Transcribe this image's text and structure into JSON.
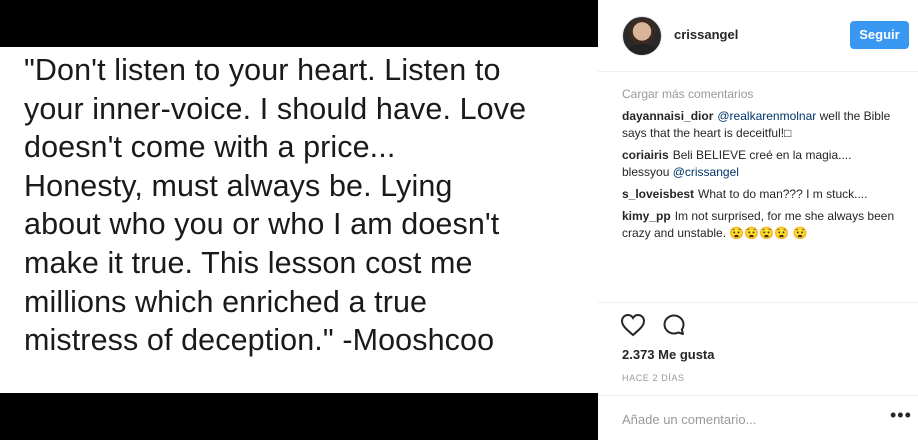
{
  "media": {
    "quote": "\"Don't listen to your heart. Listen to\nyour inner-voice. I should have. Love\ndoesn't come with a price...\nHonesty, must always be.  Lying\nabout who you or who I am doesn't\nmake it true. This lesson cost me\nmillions which enriched a true\nmistress of deception.\" -Mooshcoo"
  },
  "header": {
    "username": "crissangel",
    "follow_label": "Seguir"
  },
  "comments": {
    "load_more": "Cargar más comentarios",
    "items": [
      {
        "author": "dayannaisi_dior",
        "mention": "@realkarenmolnar",
        "text": " well the Bible says that the heart is deceitful!□"
      },
      {
        "author": "coriairis",
        "text": "Beli BELIEVE creé en la magia.... blessyou ",
        "mention": "@crissangel"
      },
      {
        "author": "s_loveisbest",
        "text": "What to do man??? I m stuck...."
      },
      {
        "author": "kimy_pp",
        "text": "Im not surprised, for me she always been crazy and unstable. 😧😧😧😧 😧"
      }
    ]
  },
  "actions": {
    "like_icon": "heart-icon",
    "comment_icon": "comment-icon"
  },
  "likes": "2.373 Me gusta",
  "time": "HACE 2 DÍAS",
  "add_comment_placeholder": "Añade un comentario...",
  "more_options": "•••",
  "colors": {
    "accent": "#3897f0",
    "mention": "#003569",
    "muted": "#999999"
  }
}
